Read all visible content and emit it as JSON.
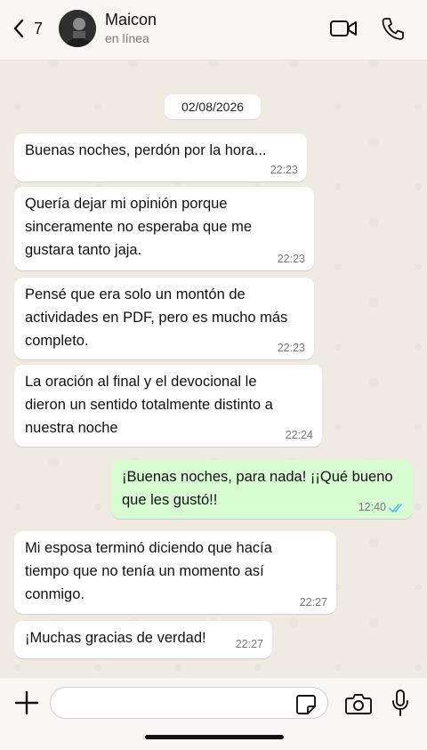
{
  "header": {
    "back_count": "7",
    "contact_name": "Maicon",
    "contact_status": "en línea",
    "icons": [
      "chevron-left-icon",
      "video-call-icon",
      "phone-icon"
    ]
  },
  "date_label": "02/08/2026",
  "messages": [
    {
      "direction": "in",
      "text": "Buenas noches, perdón por la hora...",
      "time": "22:23"
    },
    {
      "direction": "in",
      "text": "Quería dejar mi opinión porque sinceramente no esperaba que me gustara tanto jaja.",
      "time": "22:23"
    },
    {
      "direction": "in",
      "text": "Pensé que era solo un montón de actividades en PDF, pero es mucho más completo.",
      "time": "22:23"
    },
    {
      "direction": "in",
      "text": "La oración al final y el devocional le dieron un sentido totalmente distinto a nuestra noche",
      "time": "22:24"
    },
    {
      "direction": "out",
      "text": "¡Buenas noches, para nada! ¡¡Qué bueno que les gustó!!",
      "time": "12:40",
      "status": "read"
    },
    {
      "direction": "in",
      "text": "Mi esposa terminó diciendo que hacía tiempo que no tenía un momento así conmigo.",
      "time": "22:27"
    },
    {
      "direction": "in",
      "text": "¡Muchas gracias de verdad!",
      "time": "22:27"
    }
  ],
  "composer": {
    "value": "",
    "placeholder": "",
    "icons": [
      "plus-icon",
      "sticker-icon",
      "camera-icon",
      "microphone-icon"
    ]
  },
  "colors": {
    "incoming_bubble": "#ffffff",
    "outgoing_bubble": "#d9fdd3",
    "read_ticks": "#53bdeb",
    "chat_background": "#efeae2"
  }
}
